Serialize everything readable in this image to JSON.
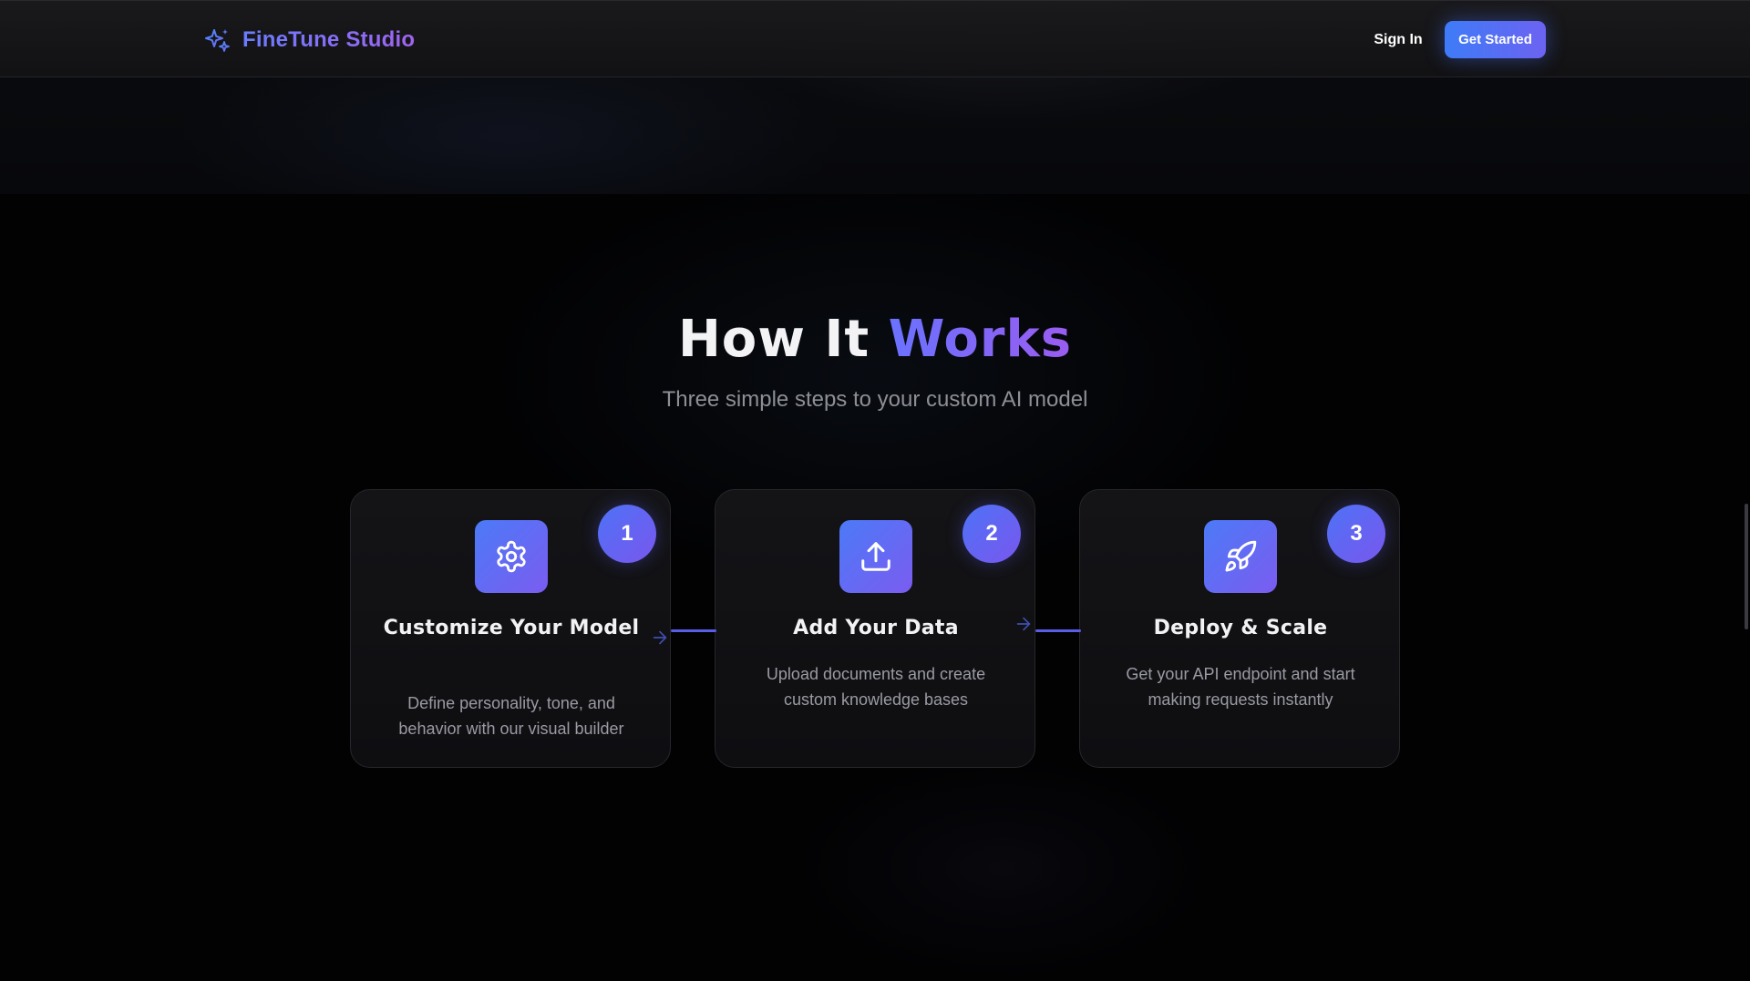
{
  "navbar": {
    "brand_name": "FineTune Studio",
    "brand_icon": "sparkles-icon",
    "sign_in_label": "Sign In",
    "cta_label": "Get Started"
  },
  "section": {
    "title_plain": "How It",
    "title_highlight": "Works",
    "subtitle": "Three simple steps to your custom AI model"
  },
  "steps": [
    {
      "number": "1",
      "icon": "gear-icon",
      "title": "Customize Your Model",
      "description": "Define personality, tone, and behavior with our visual builder"
    },
    {
      "number": "2",
      "icon": "upload-icon",
      "title": "Add Your Data",
      "description": "Upload documents and create custom knowledge bases"
    },
    {
      "number": "3",
      "icon": "rocket-icon",
      "title": "Deploy & Scale",
      "description": "Get your API endpoint and start making requests instantly"
    }
  ],
  "colors": {
    "accent_blue": "#3e7bf7",
    "accent_purple": "#7b5cf0",
    "background": "#020203",
    "card_background": "#121215",
    "muted_text": "#9a9ba3"
  }
}
